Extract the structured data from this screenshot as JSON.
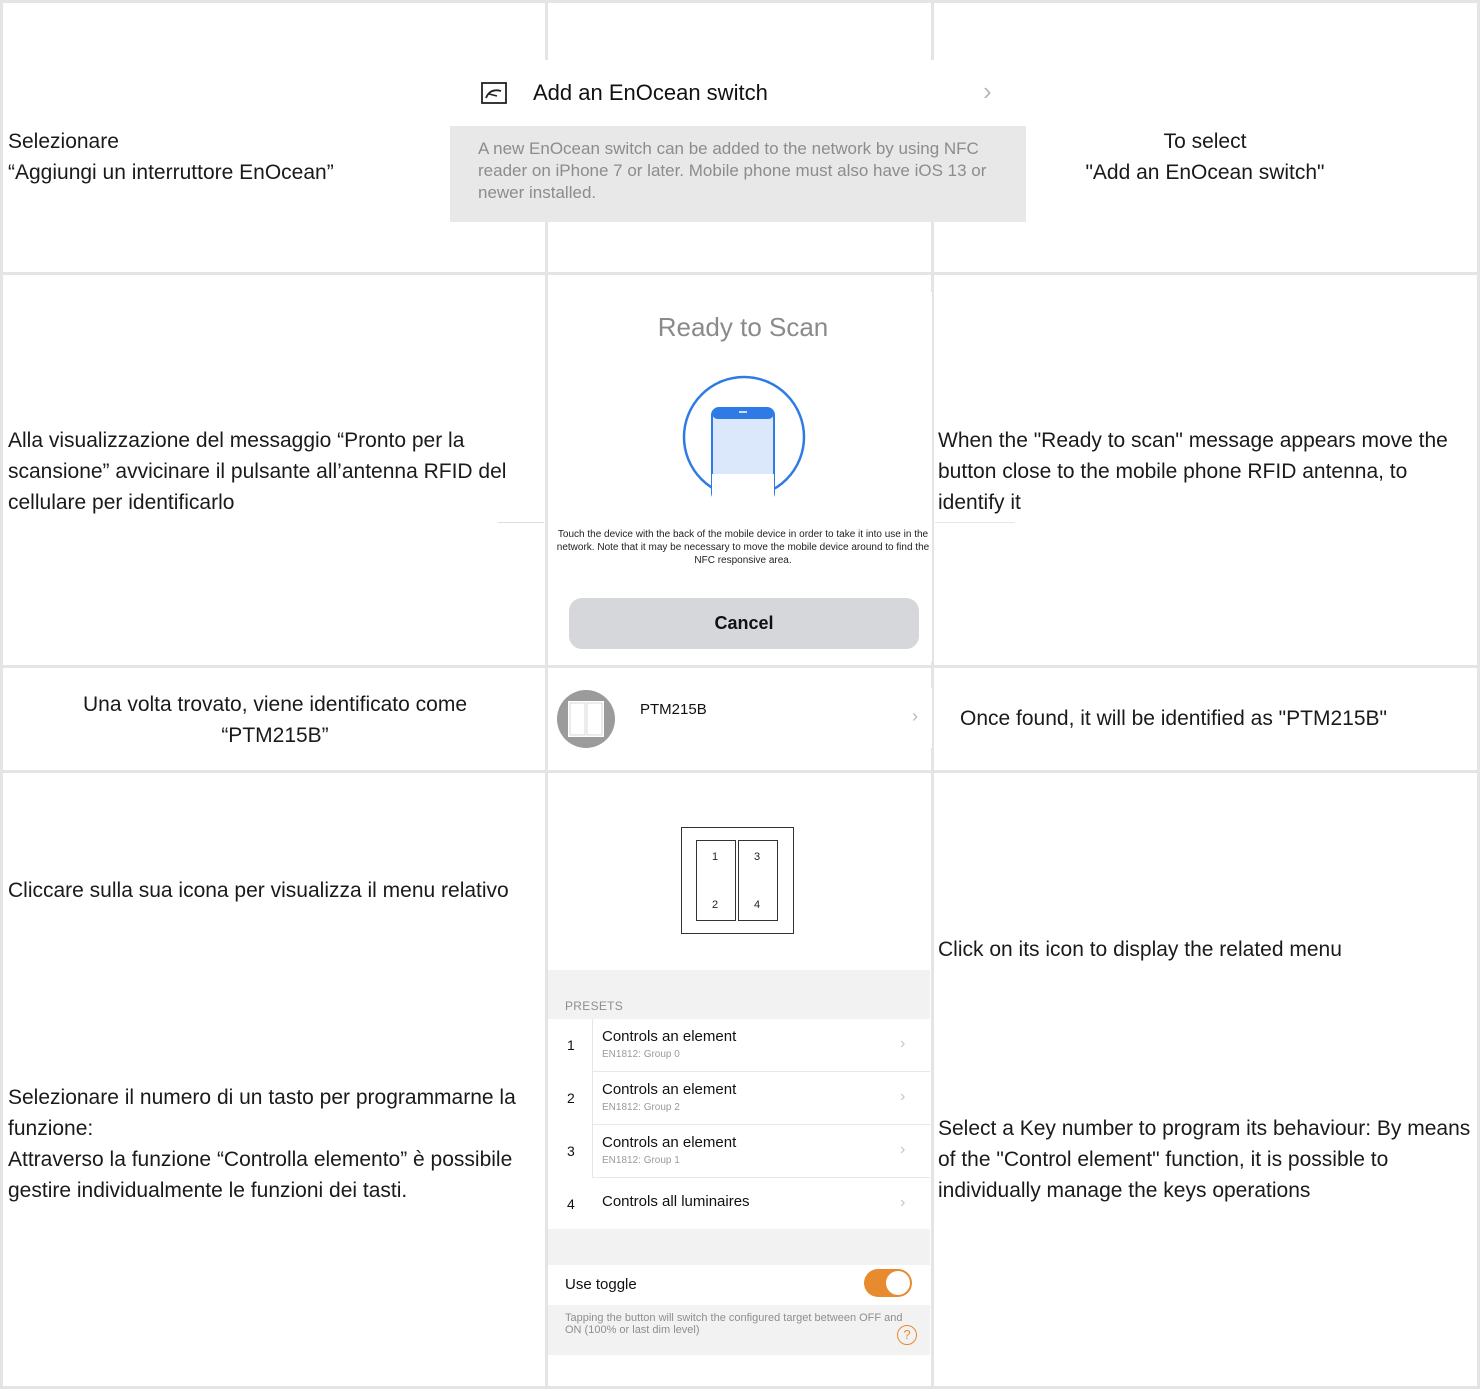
{
  "row1": {
    "left_caption": [
      "Selezionare",
      "“Aggiungi un interruttore EnOcean”"
    ],
    "right_caption": [
      "To select",
      "\"Add an EnOcean switch\""
    ],
    "card": {
      "icon": "enocean-switch-icon",
      "title": "Add an EnOcean switch",
      "chevron": "›",
      "description": "A new EnOcean switch can be added to the network by using NFC reader on iPhone 7 or later. Mobile phone must also have iOS 13 or newer installed."
    }
  },
  "row2": {
    "left_caption": "Alla visualizzazione del messaggio “Pronto per la scansione” avvicinare il pulsante all’antenna RFID del cellulare per identificarlo",
    "right_caption": "When the \"Ready to scan\" message appears move the button close to the mobile phone RFID antenna, to identify it",
    "scan": {
      "title": "Ready to Scan",
      "icon": "phone-scan-icon",
      "description": "Touch the device with the back of the mobile device in order to take it into use in the network. Note that it may be necessary to move the mobile device around to find the NFC responsive area.",
      "cancel_label": "Cancel"
    }
  },
  "row3": {
    "left_caption": [
      "Una volta trovato, viene identificato come",
      "“PTM215B”"
    ],
    "right_caption": "Once found, it will be identified as \"PTM215B\"",
    "device": {
      "icon": "switch-device-icon",
      "name": "PTM215B",
      "chevron": "›"
    }
  },
  "row4": {
    "left_caption_1": "Cliccare sulla sua icona per visualizza il menu relativo",
    "left_caption_2": [
      "Selezionare il numero di un tasto per programmarne la funzione:",
      "Attraverso la funzione “Controlla elemento” è possibile gestire individualmente le funzioni dei tasti."
    ],
    "right_caption_1": "Click on its icon to display the related menu",
    "right_caption_2": "Select a Key number to program its behaviour: By means of the \"Control element\" function, it is possible to individually manage the keys operations",
    "switch_keys": [
      "1",
      "3",
      "2",
      "4"
    ],
    "presets_label": "PRESETS",
    "presets": [
      {
        "num": "1",
        "title": "Controls an element",
        "sub": "EN1812: Group 0"
      },
      {
        "num": "2",
        "title": "Controls an element",
        "sub": "EN1812: Group 2"
      },
      {
        "num": "3",
        "title": "Controls an element",
        "sub": "EN1812: Group 1"
      },
      {
        "num": "4",
        "title": "Controls all luminaires",
        "sub": ""
      }
    ],
    "toggle": {
      "label": "Use toggle",
      "on": true,
      "accent": "#e88a2e",
      "note": "Tapping the button will switch the configured target between OFF and ON (100% or last dim level)",
      "help": "?"
    }
  }
}
